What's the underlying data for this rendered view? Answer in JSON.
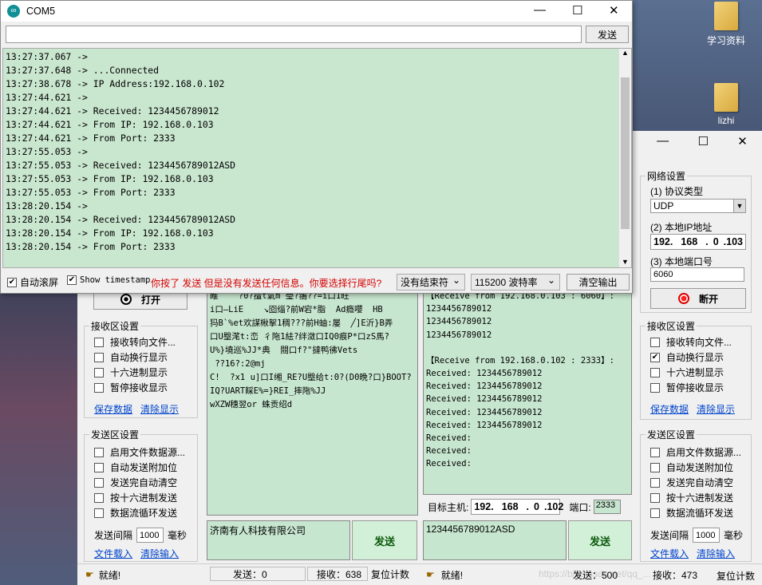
{
  "desktop": {
    "icon1_label": "学习资料",
    "icon2_label": "lizhi"
  },
  "com_window": {
    "title": "COM5",
    "send_input_value": "",
    "send_button": "发送",
    "log": [
      "13:27:37.067 ->",
      "13:27:37.648 -> ...Connected",
      "13:27:38.678 -> IP Address:192.168.0.102",
      "13:27:44.621 ->",
      "13:27:44.621 -> Received: 1234456789012",
      "13:27:44.621 -> From IP: 192.168.0.103",
      "13:27:44.621 -> From Port: 2333",
      "13:27:55.053 ->",
      "13:27:55.053 -> Received: 1234456789012ASD",
      "13:27:55.053 -> From IP: 192.168.0.103",
      "13:27:55.053 -> From Port: 2333",
      "13:28:20.154 ->",
      "13:28:20.154 -> Received: 1234456789012ASD",
      "13:28:20.154 -> From IP: 192.168.0.103",
      "13:28:20.154 -> From Port: 2333"
    ],
    "autoscroll_label": "自动滚屏",
    "timestamp_label": "Show timestamp",
    "warning": "你按了 发送 但是没有发送任何信息。你要选择行尾吗?",
    "line_ending": "没有结束符",
    "baud": "115200 波特率",
    "clear_button": "清空输出"
  },
  "left_assistant": {
    "open_button": "打开",
    "recv_settings_title": "接收区设置",
    "recv_options": [
      "接收转向文件...",
      "自动换行显示",
      "十六进制显示",
      "暂停接收显示"
    ],
    "save_data": "保存数据",
    "clear_display": "清除显示",
    "send_settings_title": "发送区设置",
    "send_options": [
      "启用文件数据源...",
      "自动发送附加位",
      "发送完自动清空",
      "按十六进制发送",
      "数据流循环发送"
    ],
    "interval_label": "发送间隔",
    "interval_value": "1000",
    "interval_unit": "毫秒",
    "file_load": "文件载入",
    "clear_input": "清除输入",
    "garbled": [
      "睢    ?0?擅t氣m 璺?翵??=i口1旺",
      "i口—LiE    ↘囵缁?前W宕*脂  Ad瘾嚶  HB",
      "犸B`%et欢謀楸挐1稠???前H蚰:屡  ╱]E沂}B弄",
      "口U壂滗t:峦 彳陁1紶?绊潋口IQ0痕P*口zS馬?",
      "U%}墝巡%JJ*典  閸口f?\"撻鸭彿Vets",
      " ??16?:2@mj",
      "C!  ?x1 u]口I缃_RE?U壂给t:0?(D0晩?口}BOOT?",
      "IQ?UART睬E%=}REI_摔陁%JJ",
      "wXZW穗翌or 蛛贡绍d"
    ],
    "send_text": "济南有人科技有限公司",
    "send_button": "发送",
    "status": "就绪!",
    "sent_count": "发送：0",
    "recv_count": "接收：638",
    "reset_count": "复位计数"
  },
  "right_assistant": {
    "net_title": "网络设置",
    "protocol_label": "(1) 协议类型",
    "protocol_value": "UDP",
    "local_ip_label": "(2) 本地IP地址",
    "local_ip": [
      "192",
      "168",
      "0",
      "103"
    ],
    "local_port_label": "(3) 本地端口号",
    "local_port": "6060",
    "disconnect_button": "断开",
    "recv_settings_title": "接收区设置",
    "recv_options": [
      "接收转向文件...",
      "自动换行显示",
      "十六进制显示",
      "暂停接收显示"
    ],
    "save_data": "保存数据",
    "clear_display": "清除显示",
    "send_settings_title": "发送区设置",
    "send_options": [
      "启用文件数据源...",
      "自动发送附加位",
      "发送完自动清空",
      "按十六进制发送",
      "数据流循环发送"
    ],
    "interval_label": "发送间隔",
    "interval_value": "1000",
    "interval_unit": "毫秒",
    "file_load": "文件载入",
    "clear_input": "清除输入",
    "recv_lines": [
      "【Receive from 192.168.0.103 : 6060】:",
      "1234456789012",
      "1234456789012",
      "1234456789012",
      "",
      "【Receive from 192.168.0.102 : 2333】:",
      "Received: 1234456789012",
      "Received: 1234456789012",
      "Received: 1234456789012",
      "Received: 1234456789012",
      "Received: 1234456789012",
      "Received:",
      "Received:",
      "Received:"
    ],
    "target_label": "目标主机:",
    "target_ip": [
      "192",
      "168",
      "0",
      "102"
    ],
    "port_label": "端口:",
    "port_value": "2333",
    "send_text": "1234456789012ASD",
    "send_button": "发送",
    "status": "就绪!",
    "sent_count": "发送：500",
    "recv_count": "接收：473",
    "reset_count": "复位计数",
    "watermark": "https://blog.csdn.net/qq_..."
  }
}
